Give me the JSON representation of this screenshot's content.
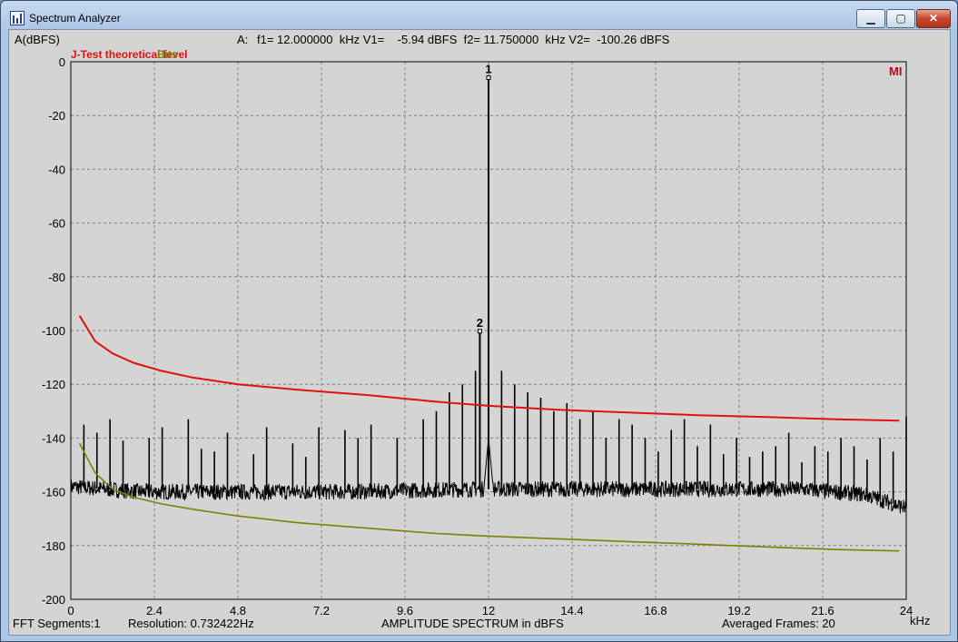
{
  "window": {
    "title": "Spectrum Analyzer"
  },
  "header": {
    "ylabel": "A(dBFS)",
    "cursor_prefix": "A:",
    "cursor_text": "f1= 12.000000  kHz V1=    -5.94 dBFS  f2= 11.750000  kHz V2=  -100.26 dBFS"
  },
  "logo": "MI",
  "footer": {
    "fft": "FFT Segments:1",
    "resolution": "Resolution: 0.732422Hz",
    "center": "AMPLITUDE SPECTRUM in dBFS",
    "frames": "Averaged Frames: 20",
    "unit": "kHz"
  },
  "colors": {
    "trace": "#000000",
    "jtest": "#e01010",
    "bits": "#808000",
    "grid": "#808080",
    "plot_bg": "#d4d4d4"
  },
  "chart_data": {
    "type": "line",
    "title": "AMPLITUDE SPECTRUM in dBFS",
    "xlabel": "kHz",
    "ylabel": "A(dBFS)",
    "xlim": [
      0,
      24
    ],
    "ylim": [
      -200,
      0
    ],
    "x_ticks": [
      "0",
      "2.4",
      "4.8",
      "7.2",
      "9.6",
      "12",
      "14.4",
      "16.8",
      "19.2",
      "21.6",
      "24"
    ],
    "y_ticks": [
      "0",
      "-20",
      "-40",
      "-60",
      "-80",
      "-100",
      "-120",
      "-140",
      "-160",
      "-180",
      "-200"
    ],
    "grid": true,
    "legend_position": "top-left",
    "series": [
      {
        "name": "J-Test theoretical level",
        "x": [
          0.25,
          0.7,
          1.2,
          1.8,
          2.6,
          3.5,
          4.8,
          6.5,
          8.5,
          10.5,
          12,
          14,
          16,
          18,
          20,
          22,
          23.8
        ],
        "y": [
          -94.5,
          -104,
          -108.5,
          -112,
          -115,
          -117.5,
          -120,
          -122,
          -124,
          -126.5,
          -128,
          -129.5,
          -130.5,
          -131.5,
          -132.2,
          -133,
          -133.5
        ]
      },
      {
        "name": "Bits",
        "x": [
          0.25,
          0.7,
          1.2,
          1.8,
          2.6,
          3.5,
          4.8,
          6.5,
          8.5,
          10.5,
          12,
          14,
          16,
          18,
          20,
          22,
          23.8
        ],
        "y": [
          -142,
          -153,
          -159,
          -162,
          -164.5,
          -166.5,
          -169,
          -171.5,
          -173.5,
          -175.5,
          -176.5,
          -177.5,
          -178.5,
          -179.5,
          -180.5,
          -181.5,
          -182
        ]
      }
    ],
    "markers": [
      {
        "label": "1",
        "x": 12.0,
        "y": -5.94
      },
      {
        "label": "2",
        "x": 11.75,
        "y": -100.26
      }
    ],
    "noise_floor": [
      {
        "x": 0.0,
        "y": -158
      },
      {
        "x": 2.0,
        "y": -160
      },
      {
        "x": 8.0,
        "y": -160
      },
      {
        "x": 11.5,
        "y": -159
      },
      {
        "x": 14.0,
        "y": -159
      },
      {
        "x": 21.0,
        "y": -159
      },
      {
        "x": 22.8,
        "y": -161
      },
      {
        "x": 24.0,
        "y": -166
      }
    ],
    "spurs": [
      {
        "x": 0.375,
        "y": -135
      },
      {
        "x": 0.75,
        "y": -138
      },
      {
        "x": 1.125,
        "y": -133
      },
      {
        "x": 1.5,
        "y": -141
      },
      {
        "x": 2.25,
        "y": -140
      },
      {
        "x": 2.625,
        "y": -136
      },
      {
        "x": 3.375,
        "y": -133
      },
      {
        "x": 3.75,
        "y": -144
      },
      {
        "x": 4.125,
        "y": -145
      },
      {
        "x": 4.5,
        "y": -138
      },
      {
        "x": 5.25,
        "y": -146
      },
      {
        "x": 5.625,
        "y": -136
      },
      {
        "x": 6.375,
        "y": -142
      },
      {
        "x": 6.75,
        "y": -147
      },
      {
        "x": 7.125,
        "y": -136
      },
      {
        "x": 7.875,
        "y": -137
      },
      {
        "x": 8.25,
        "y": -140
      },
      {
        "x": 8.625,
        "y": -135
      },
      {
        "x": 9.375,
        "y": -140
      },
      {
        "x": 10.125,
        "y": -133
      },
      {
        "x": 10.5,
        "y": -130
      },
      {
        "x": 10.875,
        "y": -123
      },
      {
        "x": 11.25,
        "y": -120
      },
      {
        "x": 11.625,
        "y": -115
      },
      {
        "x": 12.375,
        "y": -115
      },
      {
        "x": 12.75,
        "y": -120
      },
      {
        "x": 13.125,
        "y": -123
      },
      {
        "x": 13.5,
        "y": -125
      },
      {
        "x": 13.875,
        "y": -130
      },
      {
        "x": 14.25,
        "y": -127
      },
      {
        "x": 14.625,
        "y": -133
      },
      {
        "x": 15.0,
        "y": -130
      },
      {
        "x": 15.375,
        "y": -140
      },
      {
        "x": 15.75,
        "y": -133
      },
      {
        "x": 16.125,
        "y": -135
      },
      {
        "x": 16.5,
        "y": -140
      },
      {
        "x": 16.875,
        "y": -145
      },
      {
        "x": 17.25,
        "y": -137
      },
      {
        "x": 17.625,
        "y": -133
      },
      {
        "x": 18.0,
        "y": -143
      },
      {
        "x": 18.375,
        "y": -135
      },
      {
        "x": 18.75,
        "y": -146
      },
      {
        "x": 19.125,
        "y": -140
      },
      {
        "x": 19.5,
        "y": -147
      },
      {
        "x": 19.875,
        "y": -145
      },
      {
        "x": 20.25,
        "y": -143
      },
      {
        "x": 20.625,
        "y": -138
      },
      {
        "x": 21.0,
        "y": -149
      },
      {
        "x": 21.375,
        "y": -143
      },
      {
        "x": 21.75,
        "y": -145
      },
      {
        "x": 22.125,
        "y": -140
      },
      {
        "x": 22.5,
        "y": -143
      },
      {
        "x": 22.875,
        "y": -148
      },
      {
        "x": 23.25,
        "y": -140
      },
      {
        "x": 23.625,
        "y": -145
      },
      {
        "x": 24.0,
        "y": -132
      }
    ]
  }
}
